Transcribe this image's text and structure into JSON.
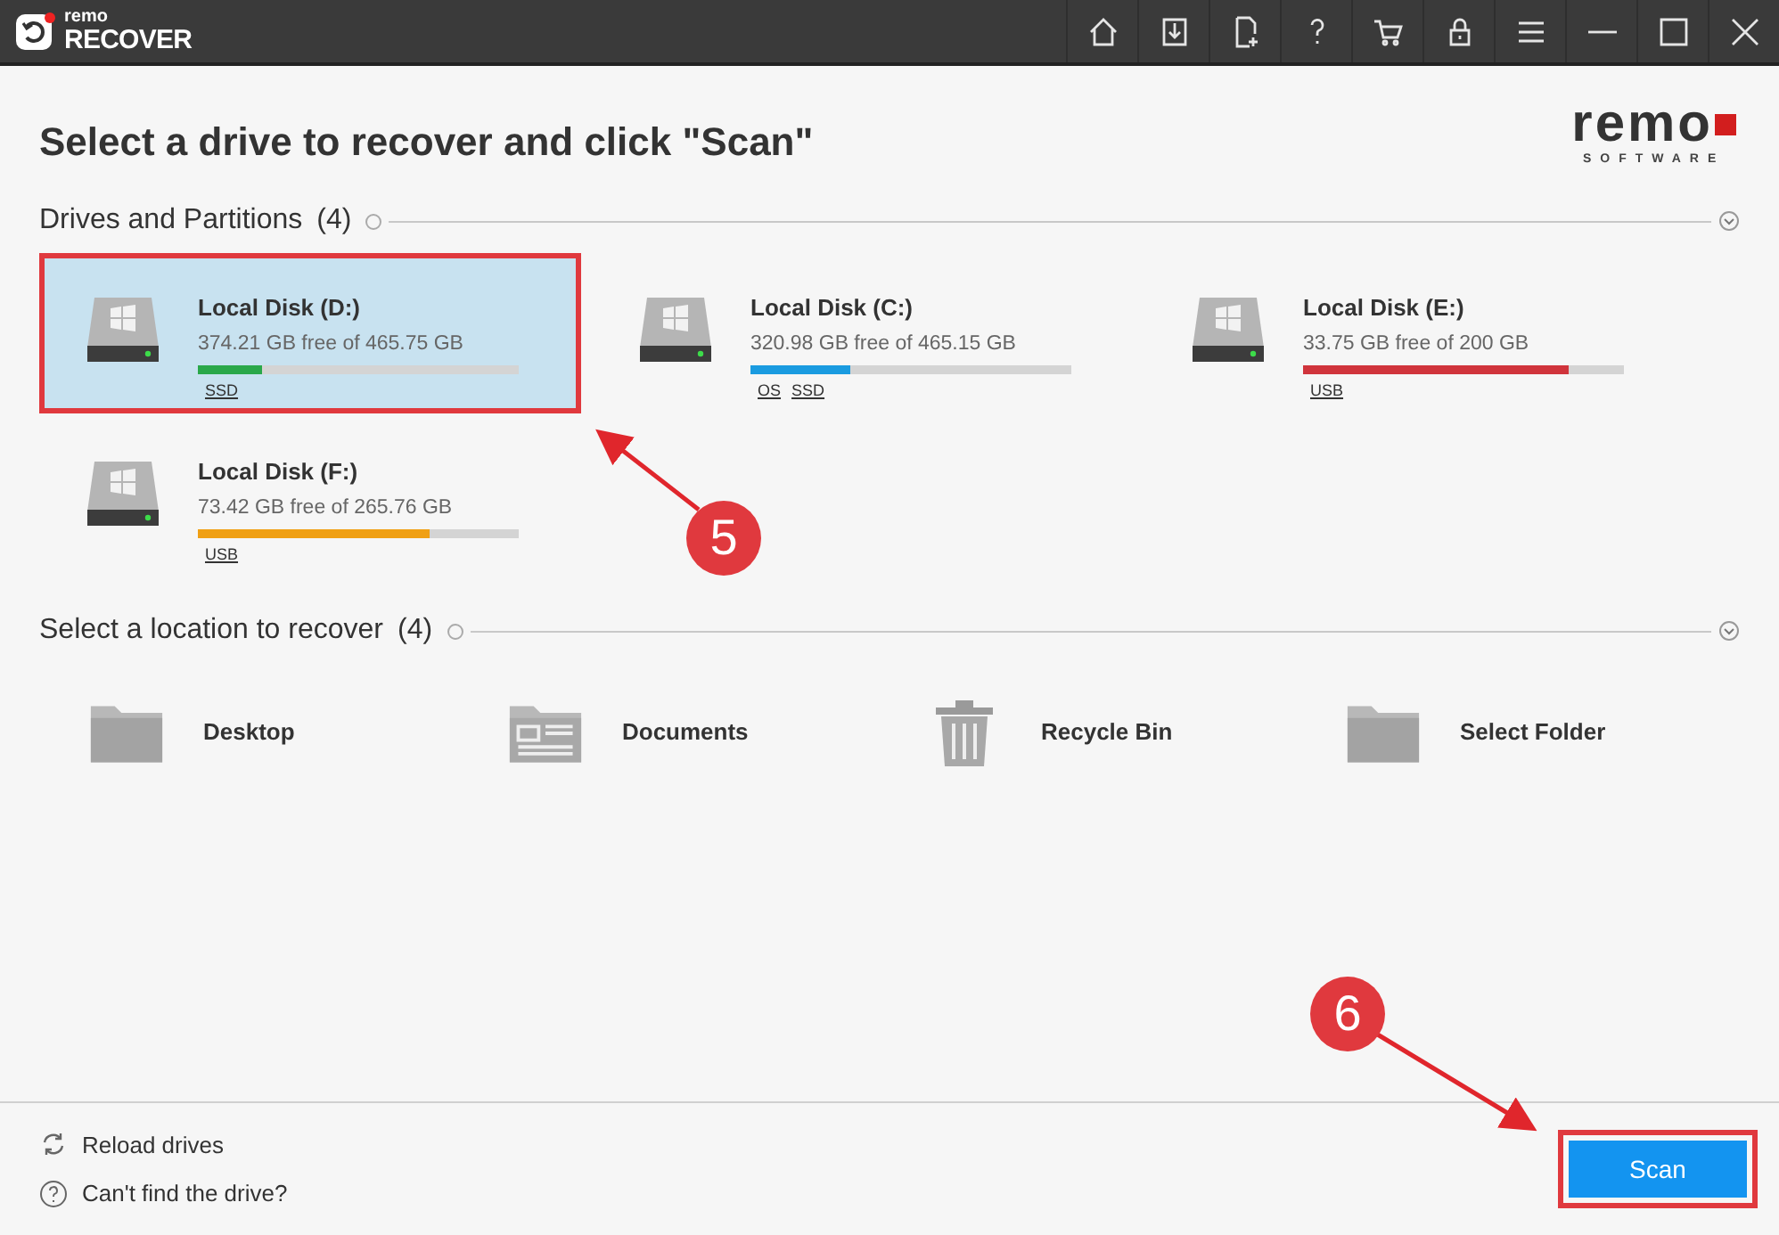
{
  "app": {
    "logo_top": "remo",
    "logo_bottom": "RECOVER"
  },
  "toolbar": [
    {
      "kind": "home"
    },
    {
      "kind": "download"
    },
    {
      "kind": "file-add"
    },
    {
      "kind": "help"
    },
    {
      "kind": "cart"
    },
    {
      "kind": "lock"
    },
    {
      "kind": "menu"
    },
    {
      "kind": "minimize"
    },
    {
      "kind": "maximize"
    },
    {
      "kind": "close"
    }
  ],
  "heading": "Select a drive to recover and click \"Scan\"",
  "brand": {
    "name": "remo",
    "tagline": "SOFTWARE"
  },
  "drives_section": {
    "title": "Drives and Partitions",
    "count": "(4)"
  },
  "drives": [
    {
      "name": "Local Disk (D:)",
      "space": "374.21 GB free of 465.75 GB",
      "level": 0.2,
      "color": "#2aa84a",
      "tags": [
        "SSD"
      ],
      "selected": true
    },
    {
      "name": "Local Disk (C:)",
      "space": "320.98 GB free of 465.15 GB",
      "level": 0.31,
      "color": "#1a9be0",
      "tags": [
        "OS",
        "SSD"
      ],
      "selected": false
    },
    {
      "name": "Local Disk (E:)",
      "space": "33.75 GB free of 200 GB",
      "level": 0.83,
      "color": "#d0343c",
      "tags": [
        "USB"
      ],
      "selected": false
    },
    {
      "name": "Local Disk (F:)",
      "space": "73.42 GB free of 265.76 GB",
      "level": 0.72,
      "color": "#f0a014",
      "tags": [
        "USB"
      ],
      "selected": false
    }
  ],
  "locations_section": {
    "title": "Select a location to recover",
    "count": "(4)"
  },
  "locations": [
    {
      "kind": "folder",
      "label": "Desktop"
    },
    {
      "kind": "document",
      "label": "Documents"
    },
    {
      "kind": "bin",
      "label": "Recycle Bin"
    },
    {
      "kind": "folder",
      "label": "Select Folder"
    }
  ],
  "footer": {
    "links": [
      {
        "kind": "reload",
        "label": "Reload drives"
      },
      {
        "kind": "help",
        "label": "Can't find the drive?"
      }
    ],
    "scan_button": "Scan"
  },
  "annotations": [
    {
      "label": "5"
    },
    {
      "label": "6"
    }
  ]
}
